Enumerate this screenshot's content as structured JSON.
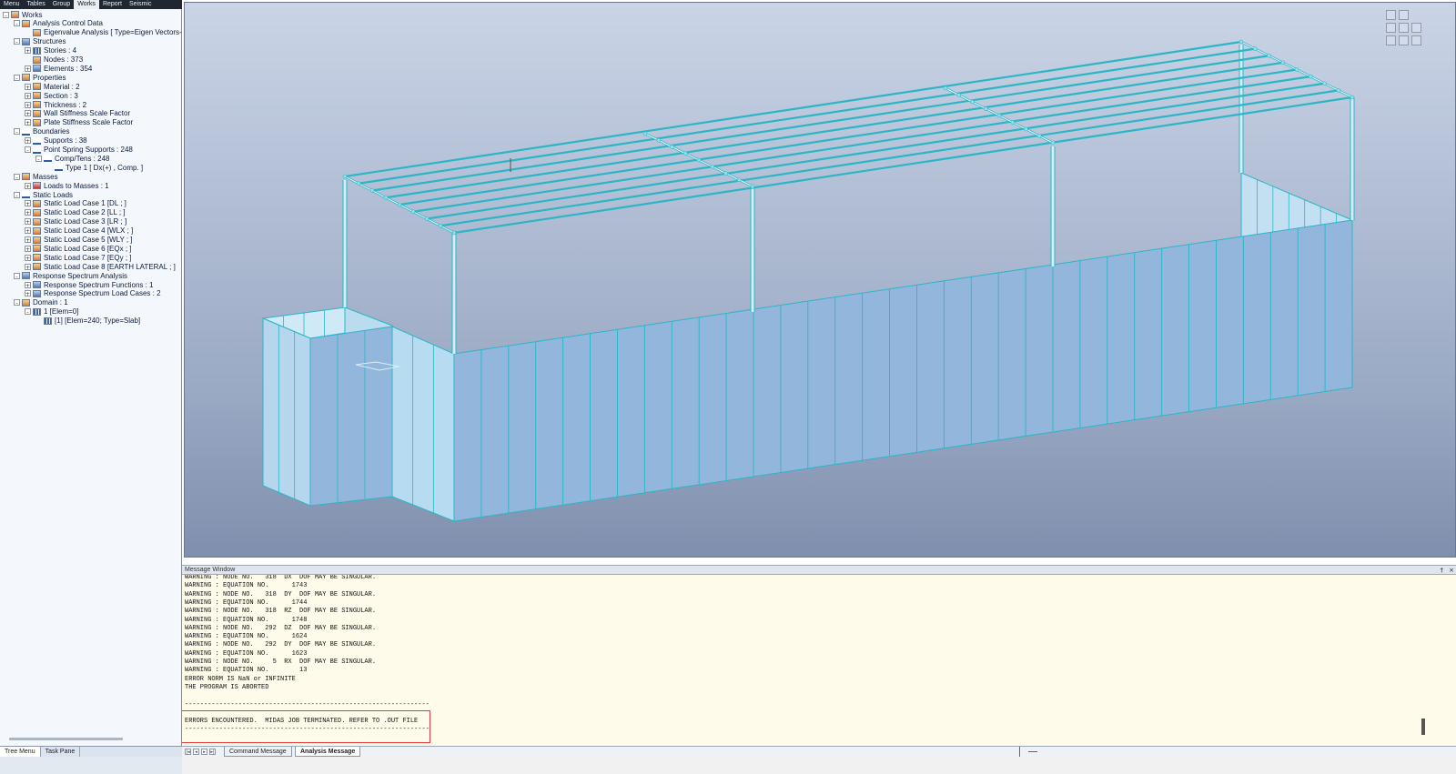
{
  "top_tabs": [
    "Menu",
    "Tables",
    "Group",
    "Works",
    "Report",
    "Seismic"
  ],
  "active_top_tab": "Works",
  "tree": [
    {
      "depth": 0,
      "toggle": "-",
      "icon": "works-icon",
      "label": "Works"
    },
    {
      "depth": 1,
      "toggle": "-",
      "icon": "analysis-control-icon",
      "label": "Analysis Control Data"
    },
    {
      "depth": 2,
      "toggle": "",
      "icon": "eigenvalue-icon",
      "label": "Eigenvalue Analysis [ Type=Eigen Vectors-"
    },
    {
      "depth": 1,
      "toggle": "-",
      "icon": "structures-icon",
      "label": "Structures"
    },
    {
      "depth": 2,
      "toggle": "+",
      "icon": "stories-icon",
      "label": "Stories : 4"
    },
    {
      "depth": 2,
      "toggle": "",
      "icon": "nodes-icon",
      "label": "Nodes : 373"
    },
    {
      "depth": 2,
      "toggle": "+",
      "icon": "elements-icon",
      "label": "Elements : 354"
    },
    {
      "depth": 1,
      "toggle": "-",
      "icon": "properties-icon",
      "label": "Properties"
    },
    {
      "depth": 2,
      "toggle": "+",
      "icon": "material-icon",
      "label": "Material : 2"
    },
    {
      "depth": 2,
      "toggle": "+",
      "icon": "section-icon",
      "label": "Section : 3"
    },
    {
      "depth": 2,
      "toggle": "+",
      "icon": "thickness-icon",
      "label": "Thickness : 2"
    },
    {
      "depth": 2,
      "toggle": "+",
      "icon": "wall-stiffness-icon",
      "label": "Wall Stiffness Scale Factor"
    },
    {
      "depth": 2,
      "toggle": "+",
      "icon": "plate-stiffness-icon",
      "label": "Plate Stiffness Scale Factor"
    },
    {
      "depth": 1,
      "toggle": "-",
      "icon": "boundaries-icon",
      "label": "Boundaries"
    },
    {
      "depth": 2,
      "toggle": "+",
      "icon": "supports-icon",
      "label": "Supports : 38"
    },
    {
      "depth": 2,
      "toggle": "-",
      "icon": "point-spring-icon",
      "label": "Point Spring Supports : 248"
    },
    {
      "depth": 3,
      "toggle": "-",
      "icon": "comp-tens-icon",
      "label": "Comp/Tens : 248"
    },
    {
      "depth": 4,
      "toggle": "",
      "icon": "spring-type-icon",
      "label": "Type 1 [ Dx(+) , Comp. ]"
    },
    {
      "depth": 1,
      "toggle": "-",
      "icon": "masses-icon",
      "label": "Masses"
    },
    {
      "depth": 2,
      "toggle": "+",
      "icon": "loads-to-masses-icon",
      "label": "Loads to Masses : 1"
    },
    {
      "depth": 1,
      "toggle": "-",
      "icon": "static-loads-icon",
      "label": "Static Loads"
    },
    {
      "depth": 2,
      "toggle": "+",
      "icon": "load-case-icon",
      "label": "Static Load Case 1 [DL ; ]"
    },
    {
      "depth": 2,
      "toggle": "+",
      "icon": "load-case-icon",
      "label": "Static Load Case 2 [LL ; ]"
    },
    {
      "depth": 2,
      "toggle": "+",
      "icon": "load-case-icon",
      "label": "Static Load Case 3 [LR ; ]"
    },
    {
      "depth": 2,
      "toggle": "+",
      "icon": "load-case-icon",
      "label": "Static Load Case 4 [WLX ; ]"
    },
    {
      "depth": 2,
      "toggle": "+",
      "icon": "load-case-icon",
      "label": "Static Load Case 5 [WLY ; ]"
    },
    {
      "depth": 2,
      "toggle": "+",
      "icon": "load-case-icon",
      "label": "Static Load Case 6 [EQx ; ]"
    },
    {
      "depth": 2,
      "toggle": "+",
      "icon": "load-case-icon",
      "label": "Static Load Case 7 [EQy ; ]"
    },
    {
      "depth": 2,
      "toggle": "+",
      "icon": "load-case-icon",
      "label": "Static Load Case 8 [EARTH LATERAL ; ]"
    },
    {
      "depth": 1,
      "toggle": "-",
      "icon": "response-spectrum-icon",
      "label": "Response Spectrum Analysis"
    },
    {
      "depth": 2,
      "toggle": "+",
      "icon": "rs-function-icon",
      "label": "Response Spectrum Functions : 1"
    },
    {
      "depth": 2,
      "toggle": "+",
      "icon": "rs-load-case-icon",
      "label": "Response Spectrum Load Cases : 2"
    },
    {
      "depth": 1,
      "toggle": "-",
      "icon": "domain-icon",
      "label": "Domain : 1"
    },
    {
      "depth": 2,
      "toggle": "-",
      "icon": "domain-item-icon",
      "label": "1 [Elem=0]"
    },
    {
      "depth": 3,
      "toggle": "",
      "icon": "slab-icon",
      "label": "[1] [Elem=240; Type=Slab]"
    }
  ],
  "left_bottom_tabs": [
    "Tree Menu",
    "Task Pane"
  ],
  "active_left_bottom_tab": "Tree Menu",
  "message_window": {
    "title": "Message Window",
    "pin": "†",
    "close": "×",
    "lines": [
      "WARNING : NODE NO.   318  DX  DOF MAY BE SINGULAR.",
      "WARNING : EQUATION NO.      1743",
      "WARNING : NODE NO.   318  DY  DOF MAY BE SINGULAR.",
      "WARNING : EQUATION NO.      1744",
      "WARNING : NODE NO.   318  RZ  DOF MAY BE SINGULAR.",
      "WARNING : EQUATION NO.      1748",
      "WARNING : NODE NO.   292  DZ  DOF MAY BE SINGULAR.",
      "WARNING : EQUATION NO.      1624",
      "WARNING : NODE NO.   292  DY  DOF MAY BE SINGULAR.",
      "WARNING : EQUATION NO.      1623",
      "WARNING : NODE NO.     5  RX  DOF MAY BE SINGULAR.",
      "WARNING : EQUATION NO.        13",
      "ERROR NORM IS NaN or INFINITE",
      "THE PROGRAM IS ABORTED",
      "",
      "----------------------------------------------------------------",
      "",
      "ERRORS ENCOUNTERED.  MIDAS JOB TERMINATED. REFER TO .OUT FILE",
      "----------------------------------------------------------------"
    ]
  },
  "message_tabs": [
    "Command Message",
    "Analysis Message"
  ],
  "active_message_tab": "Analysis Message",
  "colors": {
    "model_edge": "#2bb6c6",
    "wall_fill": "#93b6dd",
    "error_box": "#e23b3b"
  }
}
